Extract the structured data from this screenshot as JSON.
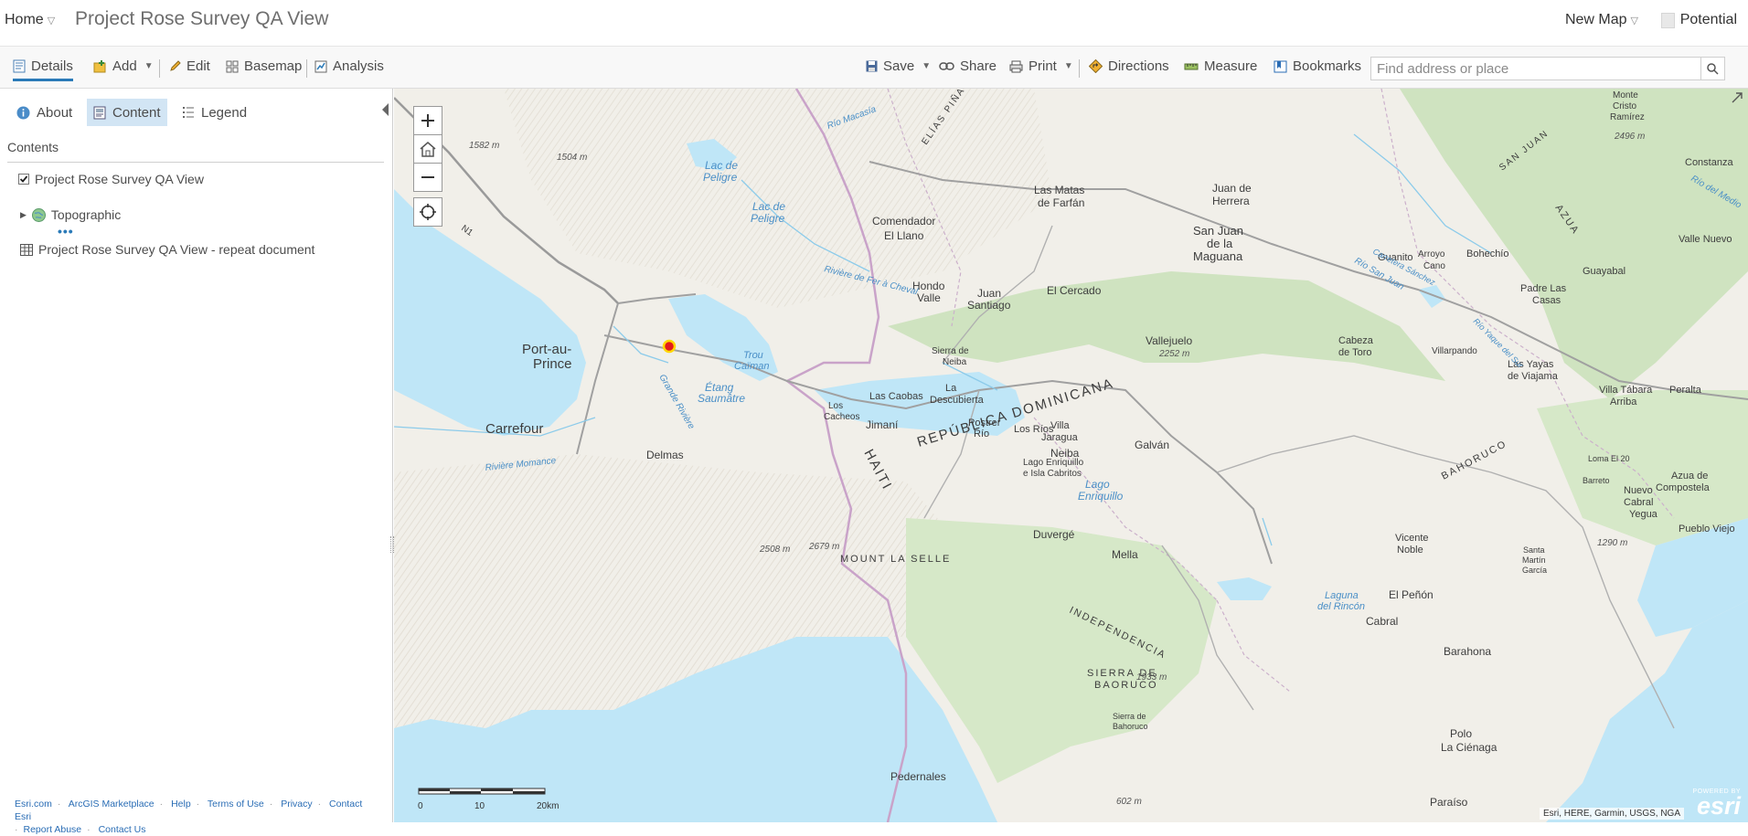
{
  "header": {
    "home_label": "Home",
    "title": "Project Rose Survey QA View",
    "new_map_label": "New Map",
    "user_label": "Potential"
  },
  "toolbar": {
    "details": "Details",
    "add": "Add",
    "edit": "Edit",
    "basemap": "Basemap",
    "analysis": "Analysis",
    "save": "Save",
    "share": "Share",
    "print": "Print",
    "directions": "Directions",
    "measure": "Measure",
    "bookmarks": "Bookmarks",
    "search_placeholder": "Find address or place"
  },
  "panel": {
    "tabs": {
      "about": "About",
      "content": "Content",
      "legend": "Legend"
    },
    "active_tab": "content",
    "contents_heading": "Contents",
    "layers": [
      {
        "label": "Project Rose Survey QA View",
        "checked": true
      },
      {
        "label": "Topographic"
      },
      {
        "label": "Project Rose Survey QA View - repeat document"
      }
    ],
    "footer_links": [
      "Esri.com",
      "ArcGIS Marketplace",
      "Help",
      "Terms of Use",
      "Privacy",
      "Contact Esri",
      "Report Abuse",
      "Contact Us"
    ]
  },
  "map": {
    "attribution": "Esri, HERE, Garmin, USGS, NGA",
    "logo_powered": "POWERED BY",
    "logo_name": "esri",
    "scale": {
      "labels": [
        "0",
        "10",
        "20km"
      ]
    },
    "colors": {
      "water": "#bfe6f7",
      "land": "#f1efe9",
      "vegetation": "#cfe3c0",
      "border": "#c9a3c9",
      "road": "#9a9a9a",
      "marker": "#e31a1c",
      "accent": "#2a7ab8"
    },
    "labels": {
      "port_au_prince_1": "Port-au-",
      "port_au_prince_2": "Prince",
      "carrefour": "Carrefour",
      "delmas": "Delmas",
      "haiti": "HAITI",
      "rep_dom": "REPÚBLICA DOMINICANA",
      "lac_peligre_1": "Lac de",
      "lac_peligre_2": "Peligre",
      "lac_peligre_b1": "Lac de",
      "lac_peligre_b2": "Peligre",
      "trou_caiman_1": "Trou",
      "trou_caiman_2": "Caïman",
      "etang_1": "Étang",
      "etang_2": "Saumâtre",
      "lago_1": "Lago Enriquillo",
      "lago_2": "e Isla Cabritos",
      "lago_b1": "Lago",
      "lago_b2": "Enriquillo",
      "comendador": "Comendador",
      "el_llano": "El Llano",
      "las_matas_1": "Las Matas",
      "las_matas_2": "de Farfán",
      "juan_herrera_1": "Juan de",
      "juan_herrera_2": "Herrera",
      "san_juan_1": "San Juan",
      "san_juan_2": "de la",
      "san_juan_3": "Maguana",
      "hondo_1": "Hondo",
      "hondo_2": "Valle",
      "juan_santiago_1": "Juan",
      "juan_santiago_2": "Santiago",
      "el_cercado": "El Cercado",
      "vallejuelo": "Vallejuelo",
      "sierra_neiba_1": "Sierra de",
      "sierra_neiba_2": "Neiba",
      "la_descubierta_1": "La",
      "la_descubierta_2": "Descubierta",
      "las_caobas": "Las Caobas",
      "los_cacheos_1": "Los",
      "los_cacheos_2": "Cacheos",
      "postrer_1": "Postrer",
      "postrer_2": "Río",
      "los_rios": "Los Ríos",
      "villa_jaragua_1": "Villa",
      "villa_jaragua_2": "Jaragua",
      "galvan": "Galván",
      "neiba": "Neiba",
      "jimani": "Jimaní",
      "duverge": "Duvergé",
      "mella": "Mella",
      "laguna_1": "Laguna",
      "laguna_2": "del Rincón",
      "el_penon": "El Peñón",
      "cabral": "Cabral",
      "barahona": "Barahona",
      "vicente_1": "Vicente",
      "vicente_2": "Noble",
      "polo": "Polo",
      "la_cienaga": "La Ciénaga",
      "paraiso": "Paraíso",
      "pedernales": "Pedernales",
      "mount_selle": "MOUNT LA SELLE",
      "sierra_baoruco_1": "SIERRA DE",
      "sierra_baoruco_2": "BAORUCO",
      "sierra_bahoruco_1": "Sierra de",
      "sierra_bahoruco_2": "Bahoruco",
      "independencia": "INDEPENDENCIA",
      "bahoruco": "BAHORUCO",
      "azua": "AZUA",
      "elias_pina": "ELÍAS PIÑA",
      "san_juan_prov": "SAN JUAN",
      "guanito": "Guanito",
      "arroyo_cano_1": "Arroyo",
      "arroyo_cano_2": "Cano",
      "bohechio": "Bohechío",
      "padre_las_casas_1": "Padre Las",
      "padre_las_casas_2": "Casas",
      "guayabal": "Guayabal",
      "constanza": "Constanza",
      "valle_nuevo": "Valle Nuevo",
      "villarpando": "Villarpando",
      "las_yayas_1": "Las Yayas",
      "las_yayas_2": "de Viajama",
      "peralta": "Peralta",
      "villa_tabara_1": "Villa Tábara",
      "villa_tabara_2": "Arriba",
      "cabeza_toro_1": "Cabeza",
      "cabeza_toro_2": "de Toro",
      "loma": "Loma El 20",
      "azua_1": "Azua de",
      "azua_2": "Compostela",
      "barreto": "Barreto",
      "nuevo_1": "Nuevo",
      "nuevo_2": "Cabral",
      "nuevo_3": "Yegua",
      "pueblo_viejo": "Pueblo Viejo",
      "santa_1": "Santa",
      "santa_2": "Martín",
      "santa_3": "García",
      "monte_1": "Monte",
      "monte_2": "Cristo",
      "monte_3": "Ramírez",
      "n1": "N1",
      "grande_riviere": "Grande Rivière",
      "riviere_momance": "Rivière Momance",
      "riviere_fer": "Rivière de Fer à Cheval",
      "rio_macasia": "Río Macasía",
      "rio_san_juan": "Río San Juan",
      "rio_medio": "Río del Medio",
      "carretera": "Carretera Sánchez",
      "rio_yaque": "Río Yaque del Sur",
      "e1582": "1582 m",
      "e1504": "1504 m",
      "e2496": "2496 m",
      "e2252": "2252 m",
      "e2508": "2508 m",
      "e2679": "2679 m",
      "e1933": "1933 m",
      "e1290": "1290 m",
      "e602": "602 m"
    }
  }
}
